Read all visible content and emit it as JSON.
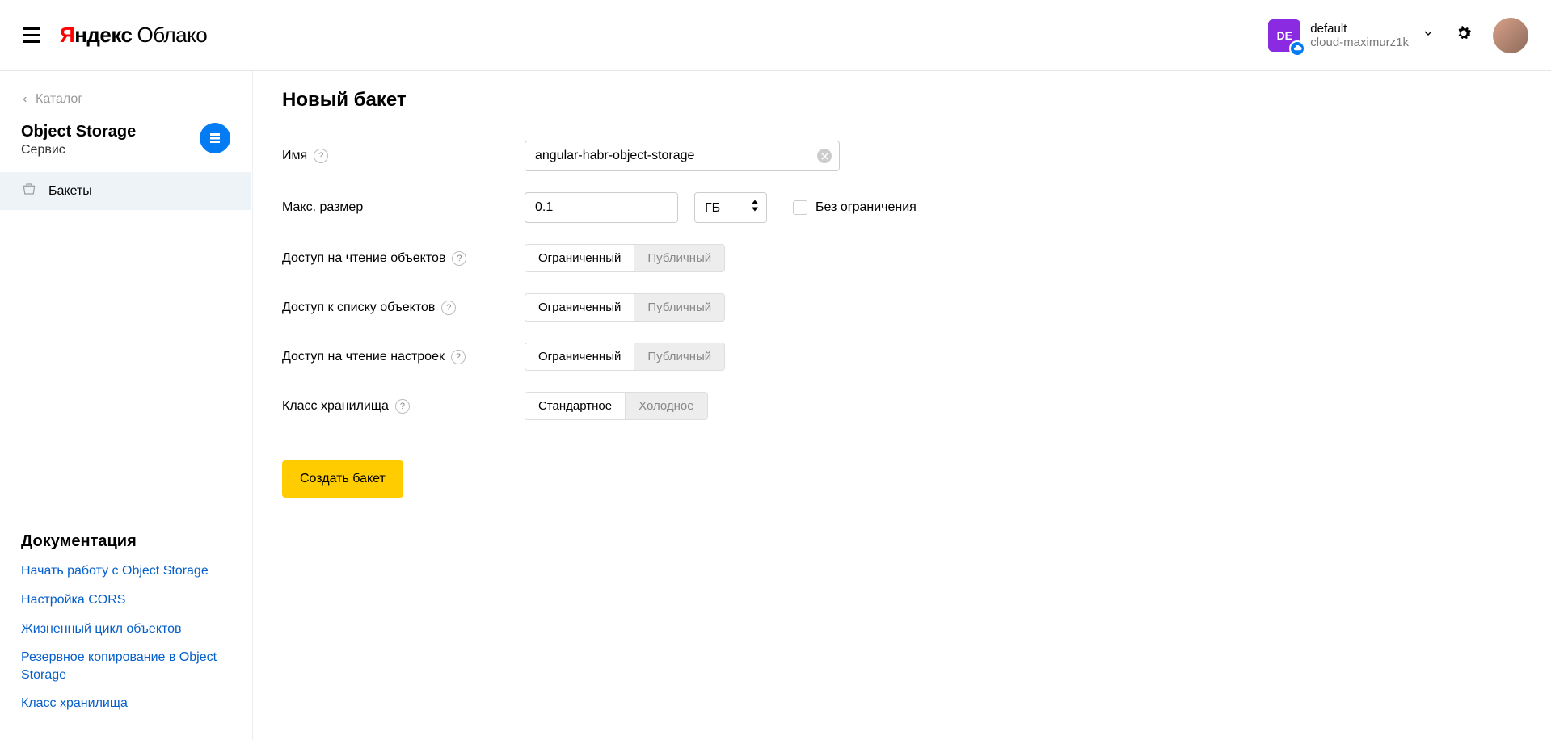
{
  "header": {
    "logo_ya": "Я",
    "logo_ndex": "ндекс",
    "logo_cloud": "Облако",
    "account_badge": "DE",
    "account_name": "default",
    "account_sub": "cloud-maximurz1k"
  },
  "sidebar": {
    "back_label": "Каталог",
    "service_title": "Object Storage",
    "service_sub": "Сервис",
    "nav_item_buckets": "Бакеты",
    "docs_title": "Документация",
    "doc_links": [
      "Начать работу с Object Storage",
      "Настройка CORS",
      "Жизненный цикл объектов",
      "Резервное копирование в Object Storage",
      "Класс хранилища"
    ]
  },
  "main": {
    "page_title": "Новый бакет",
    "labels": {
      "name": "Имя",
      "max_size": "Макс. размер",
      "unlimited": "Без ограничения",
      "read_objects": "Доступ на чтение объектов",
      "list_objects": "Доступ к списку объектов",
      "read_settings": "Доступ на чтение настроек",
      "storage_class": "Класс хранилища"
    },
    "values": {
      "name": "angular-habr-object-storage",
      "max_size": "0.1",
      "unit": "ГБ"
    },
    "segments": {
      "restricted": "Ограниченный",
      "public": "Публичный",
      "standard": "Стандартное",
      "cold": "Холодное"
    },
    "submit_label": "Создать бакет"
  }
}
